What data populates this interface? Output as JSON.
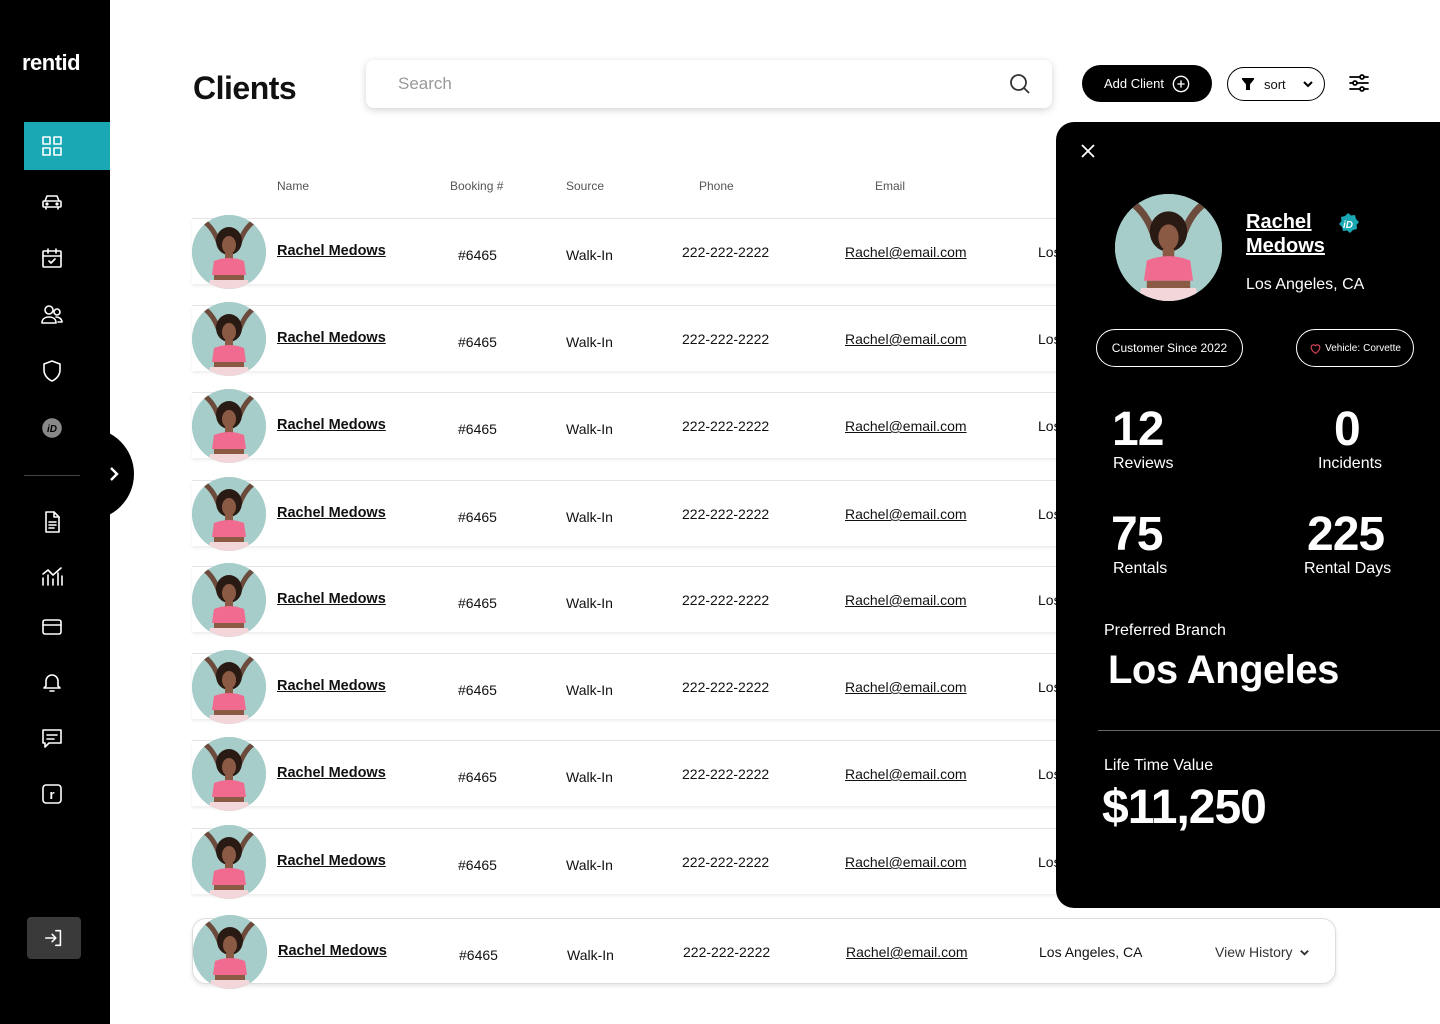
{
  "app": {
    "logo": "rentid",
    "page_title": "Clients"
  },
  "search": {
    "placeholder": "Search"
  },
  "toolbar": {
    "add_client_label": "Add Client",
    "sort_label": "sort"
  },
  "table": {
    "headers": {
      "name": "Name",
      "booking": "Booking #",
      "source": "Source",
      "phone": "Phone",
      "email": "Email"
    },
    "rows": [
      {
        "name": "Rachel Medows",
        "booking": "#6465",
        "source": "Walk-In",
        "phone": "222-222-2222",
        "email": "Rachel@email.com",
        "location": "Los"
      },
      {
        "name": "Rachel Medows",
        "booking": "#6465",
        "source": "Walk-In",
        "phone": "222-222-2222",
        "email": "Rachel@email.com",
        "location": "Los"
      },
      {
        "name": "Rachel Medows",
        "booking": "#6465",
        "source": "Walk-In",
        "phone": "222-222-2222",
        "email": "Rachel@email.com",
        "location": "Los"
      },
      {
        "name": "Rachel Medows",
        "booking": "#6465",
        "source": "Walk-In",
        "phone": "222-222-2222",
        "email": "Rachel@email.com",
        "location": "Los"
      },
      {
        "name": "Rachel Medows",
        "booking": "#6465",
        "source": "Walk-In",
        "phone": "222-222-2222",
        "email": "Rachel@email.com",
        "location": "Los"
      },
      {
        "name": "Rachel Medows",
        "booking": "#6465",
        "source": "Walk-In",
        "phone": "222-222-2222",
        "email": "Rachel@email.com",
        "location": "Los"
      },
      {
        "name": "Rachel Medows",
        "booking": "#6465",
        "source": "Walk-In",
        "phone": "222-222-2222",
        "email": "Rachel@email.com",
        "location": "Los"
      },
      {
        "name": "Rachel Medows",
        "booking": "#6465",
        "source": "Walk-In",
        "phone": "222-222-2222",
        "email": "Rachel@email.com",
        "location": "Los"
      },
      {
        "name": "Rachel Medows",
        "booking": "#6465",
        "source": "Walk-In",
        "phone": "222-222-2222",
        "email": "Rachel@email.com",
        "location": "Los Angeles, CA",
        "history": "View History"
      }
    ]
  },
  "panel": {
    "first_name": "Rachel",
    "last_name": "Medows",
    "location": "Los Angeles, CA",
    "customer_since": "Customer Since 2022",
    "vehicle_label": "Vehicle:",
    "vehicle_value": "Corvette",
    "stats": {
      "reviews": {
        "value": "12",
        "label": "Reviews"
      },
      "incidents": {
        "value": "0",
        "label": "Incidents"
      },
      "rentals": {
        "value": "75",
        "label": "Rentals"
      },
      "rental_days": {
        "value": "225",
        "label": "Rental Days"
      }
    },
    "preferred_branch_label": "Preferred Branch",
    "preferred_branch": "Los Angeles",
    "ltv_label": "Life Time Value",
    "ltv_value": "$11,250"
  },
  "colors": {
    "accent": "#1aa8b4",
    "sidebar_bg": "#000000",
    "heart": "#e0475b",
    "avatar_bg": "#a6cdc9"
  },
  "icons": {
    "nav": [
      "dashboard-grid-icon",
      "car-icon",
      "calendar-check-icon",
      "users-icon",
      "shield-icon",
      "id-badge-icon",
      "document-icon",
      "analytics-chart-icon",
      "wallet-card-icon",
      "bell-icon",
      "message-icon",
      "r-logo-icon"
    ],
    "sidebar_bottom": "logout-icon"
  }
}
